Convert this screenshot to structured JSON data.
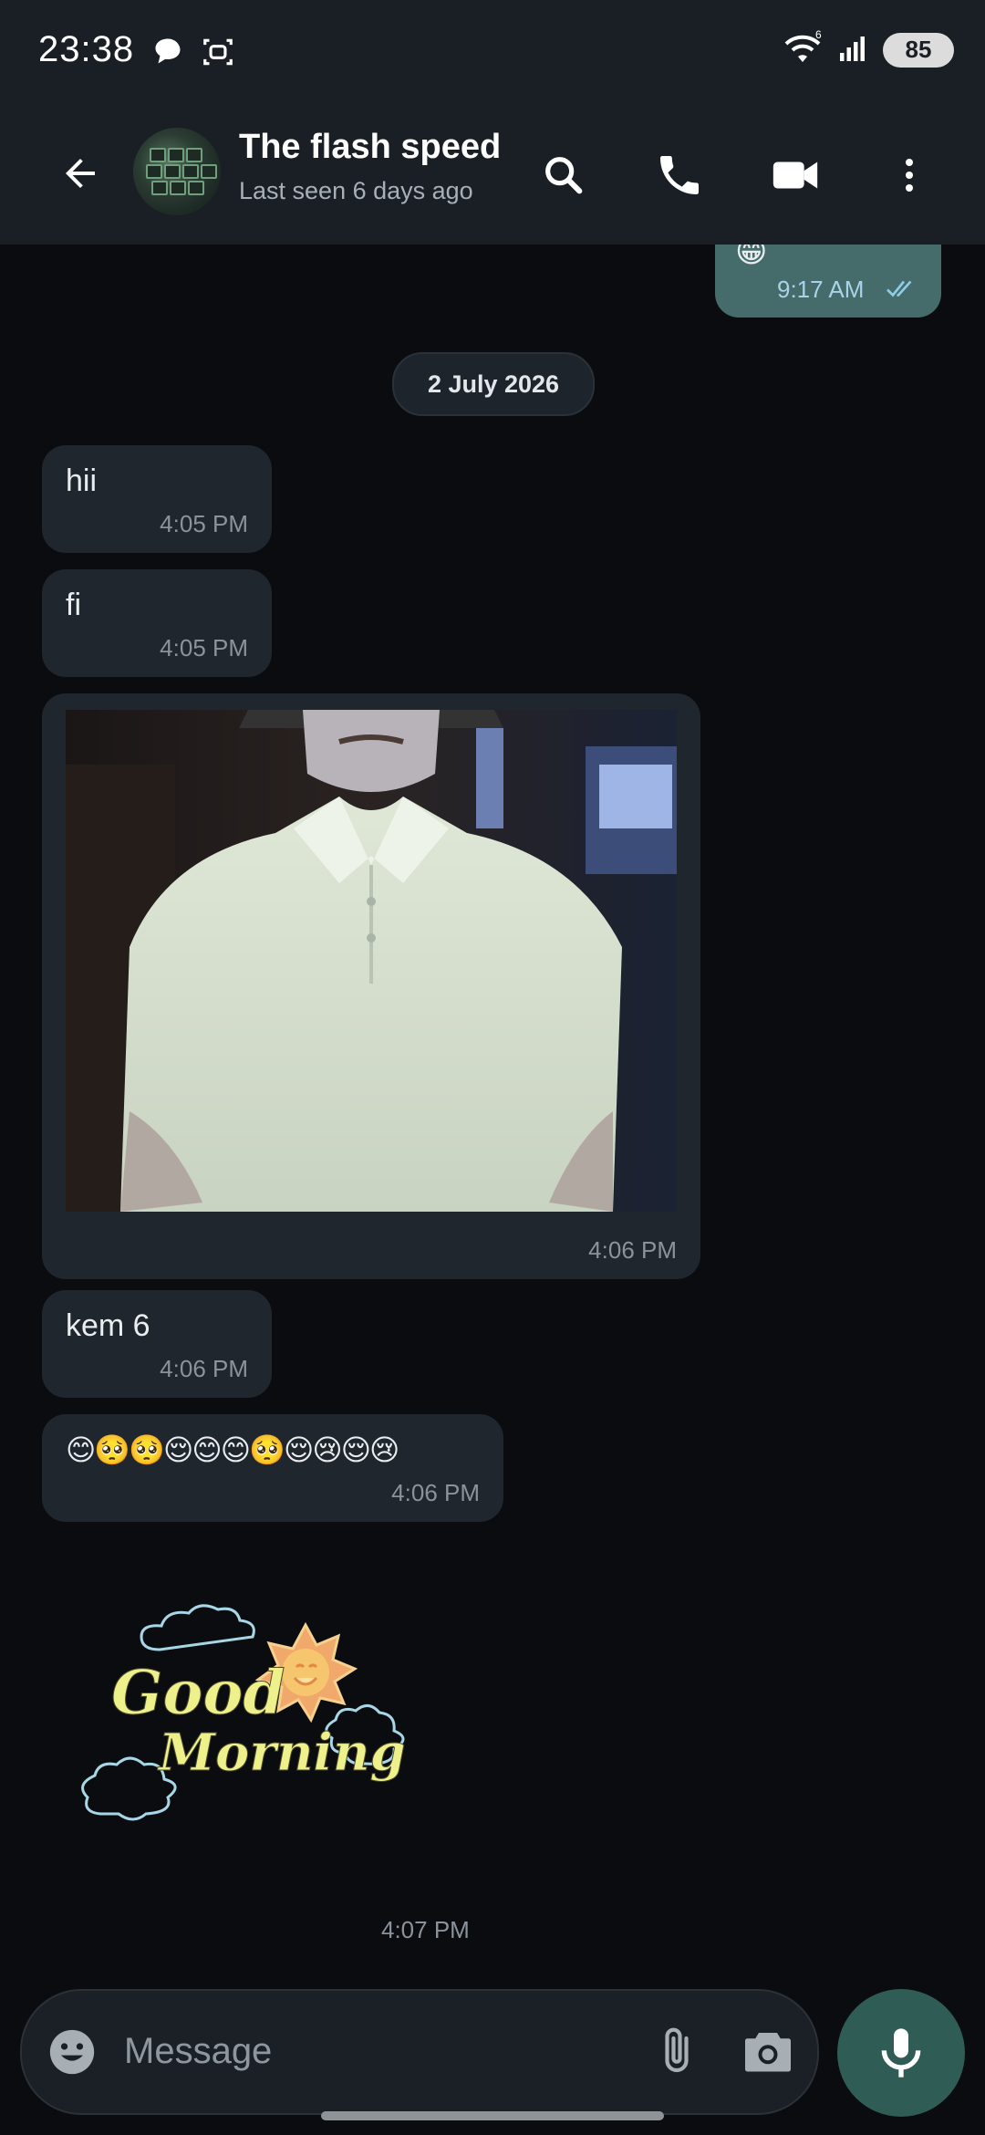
{
  "status_bar": {
    "time": "23:38",
    "battery": "85",
    "icons": [
      "chat-bubble-icon",
      "screenshot-icon",
      "wifi-icon",
      "signal-icon",
      "battery-icon"
    ]
  },
  "header": {
    "contact_name": "The flash speed",
    "contact_status": "Last seen 6 days ago",
    "icons": [
      "back-arrow-icon",
      "search-icon",
      "phone-icon",
      "video-icon",
      "more-vert-icon"
    ]
  },
  "chat": {
    "prev_outgoing": {
      "time": "9:17 AM",
      "status_icon": "double-check-icon"
    },
    "date_chip": "2 July 2026",
    "messages": [
      {
        "type": "text",
        "text": "hii",
        "time": "4:05 PM"
      },
      {
        "type": "text",
        "text": "fi",
        "time": "4:05 PM"
      },
      {
        "type": "image",
        "time": "4:06 PM"
      },
      {
        "type": "text",
        "text": "kem 6",
        "time": "4:06 PM"
      },
      {
        "type": "emoji",
        "text": "😊🥺🥺😌😊😊🥺😌😢😌😢",
        "time": "4:06 PM"
      },
      {
        "type": "sticker",
        "text_line1": "Good",
        "text_line2": "Morning",
        "time": "4:07 PM"
      }
    ]
  },
  "composer": {
    "placeholder": "Message",
    "icons": [
      "emoji-icon",
      "attach-icon",
      "camera-icon",
      "mic-icon"
    ]
  },
  "colors": {
    "background": "#0b0c10",
    "header": "#1a1f25",
    "incoming_bubble": "#20262d",
    "outgoing_bubble": "#456b6a",
    "mic_button": "#2f5c55"
  }
}
